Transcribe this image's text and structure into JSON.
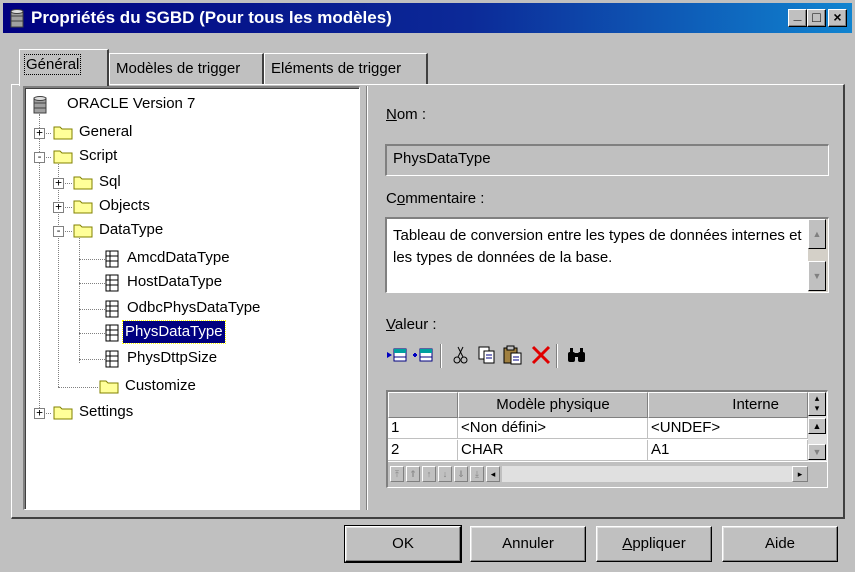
{
  "window": {
    "title": "Propriétés du SGBD (Pour tous les modèles)",
    "controls": [
      "_",
      "□",
      "×"
    ]
  },
  "tabs": [
    {
      "label": "Général",
      "active": true
    },
    {
      "label": "Modèles de trigger",
      "active": false
    },
    {
      "label": "Eléments de trigger",
      "active": false
    }
  ],
  "tree": {
    "root": "ORACLE Version 7",
    "items": {
      "general": "General",
      "script": "Script",
      "sql": "Sql",
      "objects": "Objects",
      "datatype": "DataType",
      "amcd": "AmcdDataType",
      "host": "HostDataType",
      "odbc": "OdbcPhysDataType",
      "phys": "PhysDataType",
      "physdttp": "PhysDttpSize",
      "customize": "Customize",
      "settings": "Settings"
    },
    "selected": "PhysDataType"
  },
  "form": {
    "nom_label_pre": "",
    "nom_label_u": "N",
    "nom_label_post": "om :",
    "nom_value": "PhysDataType",
    "comment_label_pre": "C",
    "comment_label_u": "o",
    "comment_label_post": "mmentaire :",
    "comment_value": "Tableau de conversion entre les types de données internes et les types de données de la base.",
    "valeur_label_u": "V",
    "valeur_label_post": "aleur :"
  },
  "toolbar_icons": [
    "insert-row-icon",
    "add-row-icon",
    "cut-icon",
    "copy-icon",
    "paste-icon",
    "delete-icon",
    "find-icon"
  ],
  "grid": {
    "columns": [
      "",
      "Modèle physique",
      "Interne"
    ],
    "rows": [
      {
        "num": "1",
        "physique": "<Non défini>",
        "interne": "<UNDEF>"
      },
      {
        "num": "2",
        "physique": "CHAR",
        "interne": "A1"
      }
    ]
  },
  "buttons": {
    "ok": "OK",
    "annuler": "Annuler",
    "appliquer_u": "A",
    "appliquer_rest": "ppliquer",
    "aide": "Aide"
  },
  "colors": {
    "title_bar": "#000080",
    "selection": "#000080",
    "folder": "#ffff99",
    "delete_icon": "#e00000"
  }
}
